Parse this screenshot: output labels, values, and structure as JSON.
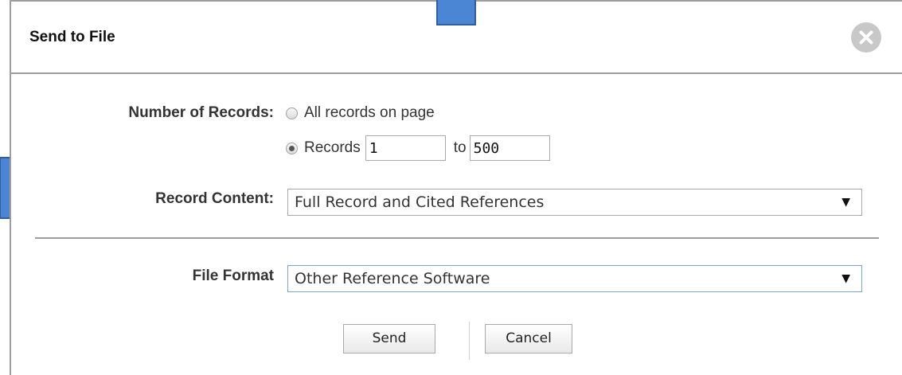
{
  "dialog": {
    "title": "Send to File"
  },
  "number_of_records": {
    "label": "Number of Records:",
    "options": [
      {
        "label": "All records on page",
        "selected": false
      },
      {
        "label": "Records",
        "selected": true
      }
    ],
    "from_value": "1",
    "to_label": "to",
    "to_value": "500"
  },
  "record_content": {
    "label": "Record Content:",
    "selected": "Full Record and Cited References"
  },
  "file_format": {
    "label": "File Format",
    "selected": "Other Reference Software"
  },
  "buttons": {
    "send": "Send",
    "cancel": "Cancel"
  },
  "colors": {
    "annotation_arrow_fill": "#4a86d4",
    "annotation_arrow_stroke": "#2f5f9e",
    "border": "#9e9e9e",
    "close_button": "#c8c8c8"
  },
  "icons": {
    "close": "close-icon",
    "dropdown": "chevron-down-icon",
    "arrow_down": "arrow-down-icon",
    "arrow_right": "arrow-right-icon"
  }
}
